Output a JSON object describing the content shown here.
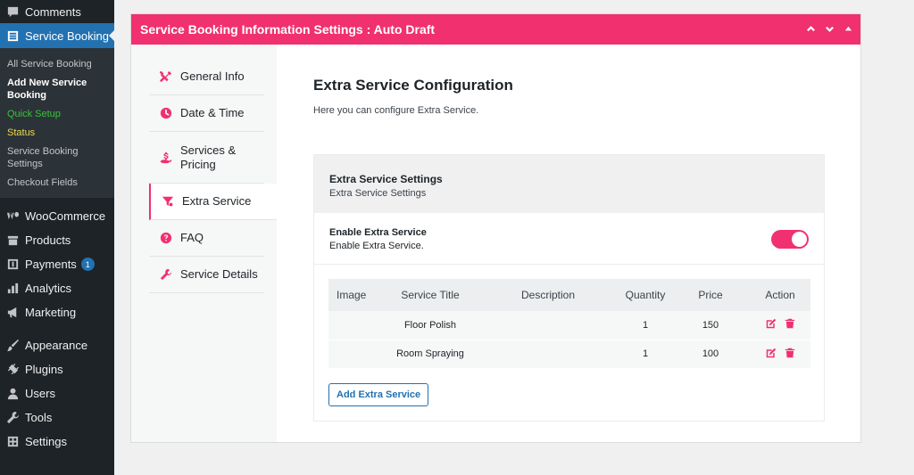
{
  "sidebar": {
    "items_top": [
      {
        "label": "Comments",
        "icon": "comments-icon"
      }
    ],
    "current": {
      "label": "Service Booking",
      "icon": "list-icon"
    },
    "submenu": [
      {
        "label": "All Service Booking",
        "style": "normal"
      },
      {
        "label": "Add New Service Booking",
        "style": "active"
      },
      {
        "label": "Quick Setup",
        "style": "green"
      },
      {
        "label": "Status",
        "style": "yellow"
      },
      {
        "label": "Service Booking Settings",
        "style": "normal"
      },
      {
        "label": "Checkout Fields",
        "style": "normal"
      }
    ],
    "items_mid": [
      {
        "label": "WooCommerce",
        "icon": "woocommerce-icon"
      },
      {
        "label": "Products",
        "icon": "archive-icon"
      },
      {
        "label": "Payments",
        "icon": "dollar-icon",
        "badge": "1"
      },
      {
        "label": "Analytics",
        "icon": "bar-chart-icon"
      },
      {
        "label": "Marketing",
        "icon": "megaphone-icon"
      }
    ],
    "items_bottom": [
      {
        "label": "Appearance",
        "icon": "paintbrush-icon"
      },
      {
        "label": "Plugins",
        "icon": "plug-icon"
      },
      {
        "label": "Users",
        "icon": "user-icon"
      },
      {
        "label": "Tools",
        "icon": "wrench-icon"
      },
      {
        "label": "Settings",
        "icon": "settings-icon"
      }
    ]
  },
  "panel": {
    "title": "Service Booking Information Settings : Auto Draft",
    "accent": "#f1306f"
  },
  "tabs": [
    {
      "label": "General Info",
      "icon": "tools-icon"
    },
    {
      "label": "Date & Time",
      "icon": "clock-icon"
    },
    {
      "label": "Services & Pricing",
      "icon": "hand-money-icon"
    },
    {
      "label": "Extra Service",
      "icon": "filter-icon",
      "active": true
    },
    {
      "label": "FAQ",
      "icon": "question-icon"
    },
    {
      "label": "Service Details",
      "icon": "wrench-icon"
    }
  ],
  "content": {
    "heading": "Extra Service Configuration",
    "subtitle": "Here you can configure Extra Service.",
    "box_heading": "Extra Service Settings",
    "box_desc": "Extra Service Settings",
    "enable_label": "Enable Extra Service",
    "enable_desc": "Enable Extra Service.",
    "enable_on": true,
    "columns": [
      "Image",
      "Service Title",
      "Description",
      "Quantity",
      "Price",
      "Action"
    ],
    "rows": [
      {
        "image": "",
        "title": "Floor Polish",
        "description": "",
        "quantity": "1",
        "price": "150"
      },
      {
        "image": "",
        "title": "Room Spraying",
        "description": "",
        "quantity": "1",
        "price": "100"
      }
    ],
    "add_button": "Add Extra Service"
  }
}
